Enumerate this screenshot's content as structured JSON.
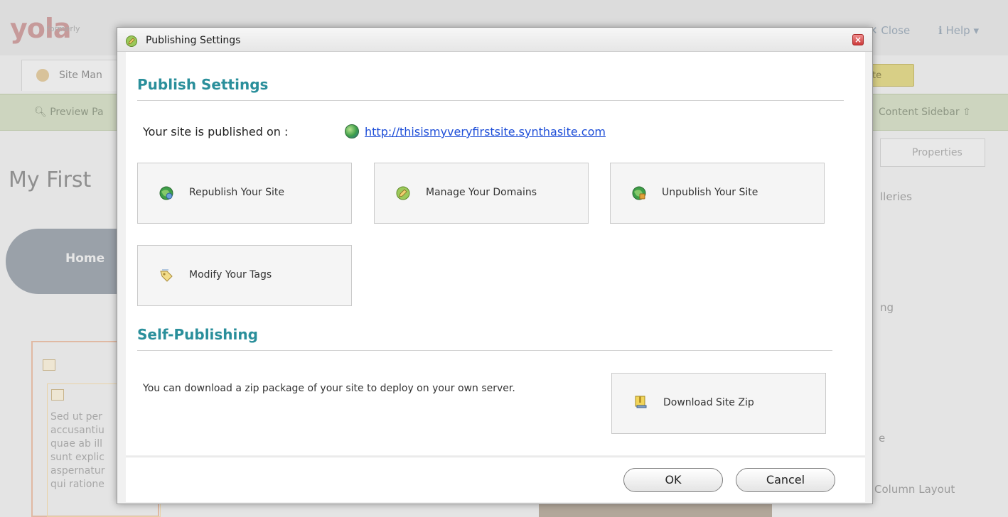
{
  "background": {
    "logo": "yola",
    "logo_sub": "formerly",
    "close_label": "Close",
    "help_label": "Help",
    "site_tab_label": "Site Man",
    "yellow_button_label": "te",
    "preview_label": "Preview Pa",
    "content_sidebar_label": "Content Sidebar",
    "properties_label": "Properties",
    "page_title": "My First",
    "home_label": "Home",
    "right_item_1": "lleries",
    "right_item_2": "ng",
    "right_item_3": "e",
    "right_item_4": "Column Layout",
    "lorem_lines": [
      "Sed ut per",
      "accusantiu",
      "quae ab ill",
      "sunt explic",
      "aspernatur",
      "qui ratione"
    ]
  },
  "dialog": {
    "title": "Publishing Settings",
    "publish_section_title": "Publish Settings",
    "published_on_label": "Your site is published on :",
    "published_url": "http://thisismyveryfirstsite.synthasite.com",
    "actions": [
      {
        "label": "Republish Your Site",
        "icon": "globe-refresh-icon"
      },
      {
        "label": "Manage Your Domains",
        "icon": "pencil-icon"
      },
      {
        "label": "Unpublish Your Site",
        "icon": "globe-lock-icon"
      },
      {
        "label": "Modify Your Tags",
        "icon": "tag-icon"
      }
    ],
    "self_publishing_title": "Self-Publishing",
    "self_publishing_text": "You can download a zip package of your site to deploy on your own server.",
    "download_label": "Download Site Zip",
    "ok_label": "OK",
    "cancel_label": "Cancel"
  },
  "colors": {
    "section_title": "#2a8f9b",
    "link": "#1f4fd8",
    "close_button": "#cc3a3a"
  }
}
